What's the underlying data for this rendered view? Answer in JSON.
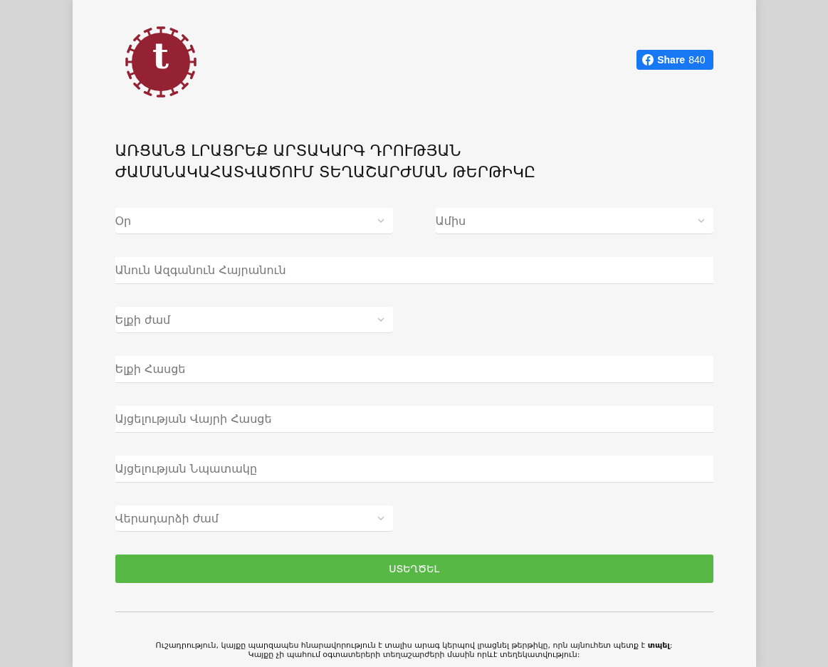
{
  "logo": {
    "letter": "t"
  },
  "share_button": {
    "label": "Share",
    "count": "840"
  },
  "title": "ԱՌՑԱՆՑ ԼՐԱՑՐԵՔ ԱՐՏԱԿԱՐԳ ԴՐՈՒԹՅԱՆ ԺԱՄԱՆԱԿԱՀԱՏՎԱԾՈՒՄ ՏԵՂԱՇԱՐԺՄԱՆ ԹԵՐԹԻԿԸ",
  "rows": [
    [
      {
        "kind": "select",
        "placeholder": "Օր"
      },
      {
        "kind": "select",
        "placeholder": "Ամիս"
      }
    ],
    [
      {
        "kind": "input",
        "placeholder": "Անուն Ազգանուն Հայրանուն"
      }
    ],
    [
      {
        "kind": "select",
        "placeholder": "Ելքի ժամ"
      }
    ],
    [
      {
        "kind": "input",
        "placeholder": "Ելքի Հասցե"
      }
    ],
    [
      {
        "kind": "input",
        "placeholder": "Այցելության Վայրի Հասցե"
      }
    ],
    [
      {
        "kind": "input",
        "placeholder": "Այցելության Նպատակը"
      }
    ],
    [
      {
        "kind": "select",
        "placeholder": "Վերադարձի ժամ"
      }
    ]
  ],
  "submit_button": "ՍՏԵՂԾԵԼ",
  "footer": [
    "Ուշադրություն, կայքը պարզապես հնարավորություն է տալիս արագ կերպով լրացնել թերթիկը, որն այնուհետ պետք է **տպել**:",
    "Կայքը չի պահում օգտատերերի տեղաշարժերի մասին որևէ տեղեկատվություն:"
  ]
}
